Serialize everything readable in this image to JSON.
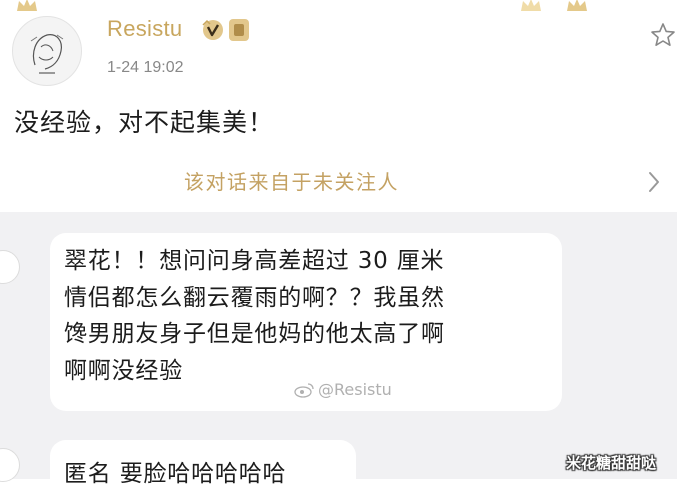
{
  "post": {
    "username": "Resistu",
    "timestamp": "1-24 19:02",
    "text": "没经验，对不起集美！"
  },
  "notice": {
    "text": "该对话来自于未关注人"
  },
  "messages": [
    {
      "lines": [
        "翠花！！想问问身高差超过 30 厘米",
        "情侣都怎么翻云覆雨的啊？？我虽然",
        "馋男朋友身子但是他妈的他太高了啊",
        "啊啊没经验"
      ]
    },
    {
      "lines": [
        "匿名 要脸哈哈哈哈哈"
      ]
    }
  ],
  "watermarks": {
    "center": "@Resistu",
    "corner": "米花糖甜甜哒"
  },
  "colors": {
    "accent_gold": "#c4a263",
    "chat_background": "#f1f1f3",
    "bubble": "#ffffff"
  },
  "icons": {
    "favorite": "star-icon",
    "more": "chevron-right-icon",
    "verified": "v-badge-icon",
    "weibo": "weibo-icon"
  }
}
